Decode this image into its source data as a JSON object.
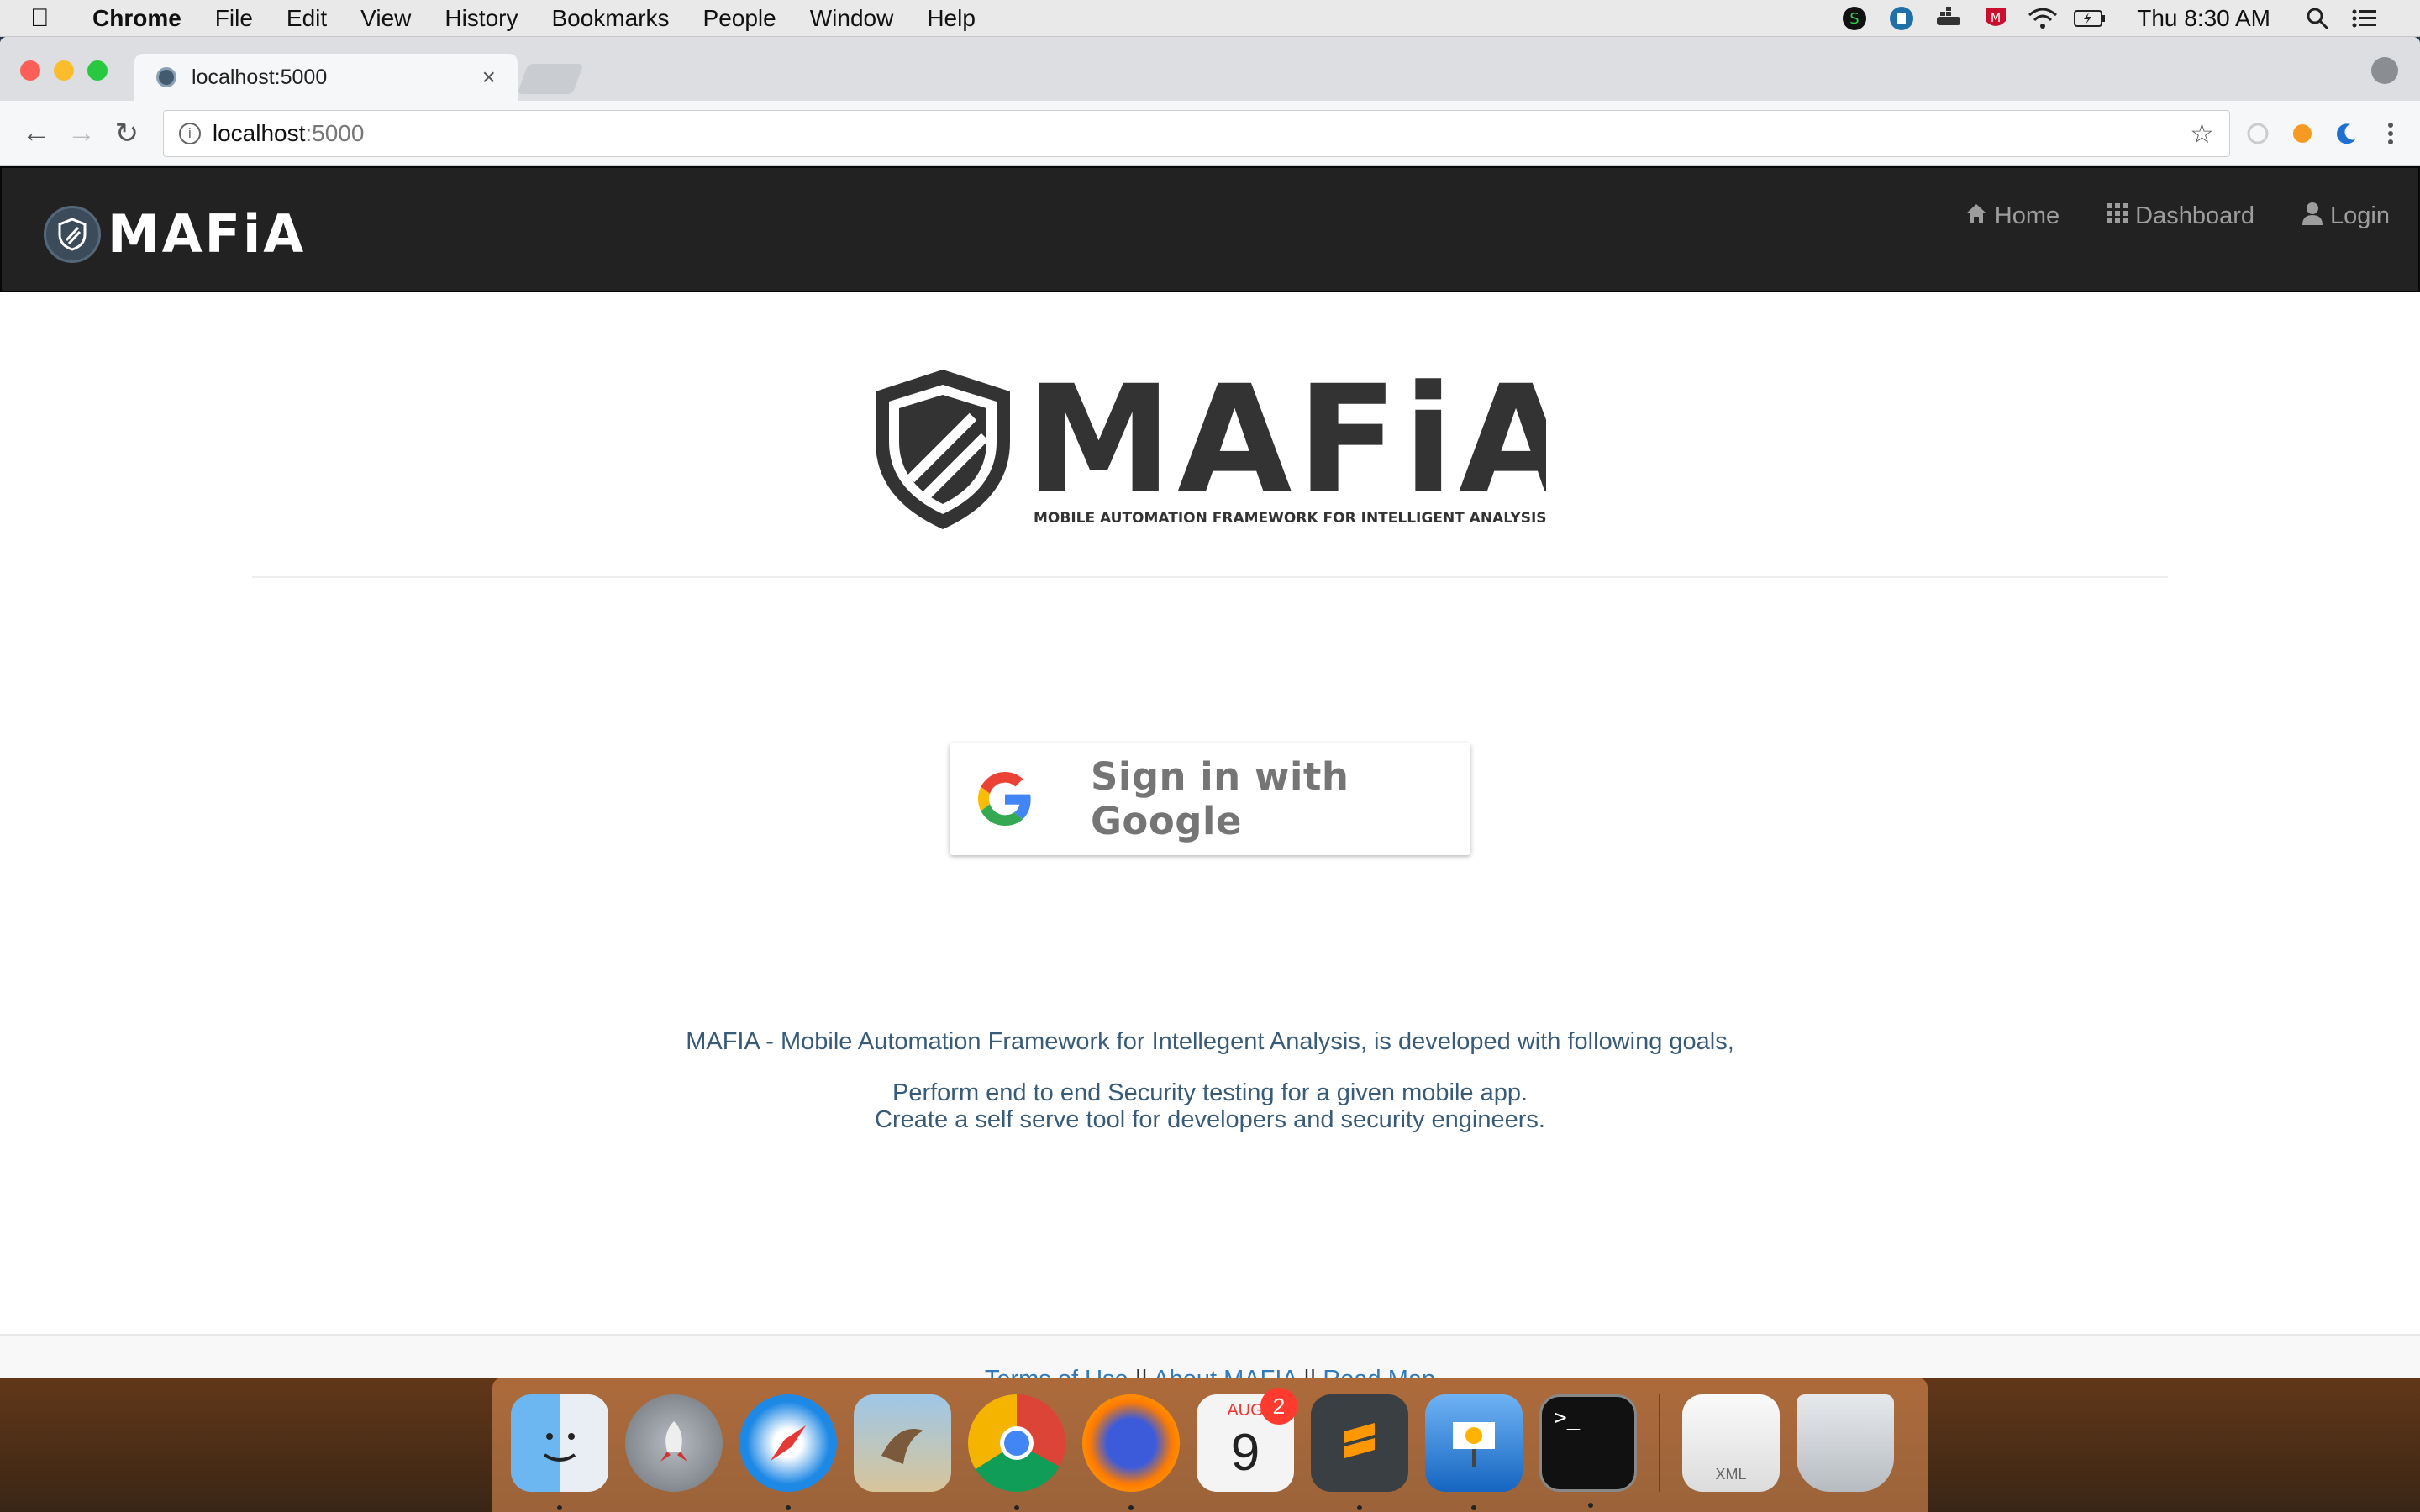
{
  "menubar": {
    "app_name": "Chrome",
    "items": [
      "File",
      "Edit",
      "View",
      "History",
      "Bookmarks",
      "People",
      "Window",
      "Help"
    ],
    "clock": "Thu 8:30 AM"
  },
  "browser": {
    "tab_title": "localhost:5000",
    "url_host": "localhost",
    "url_port": ":5000"
  },
  "navbar": {
    "brand": "MAFiA",
    "links": [
      {
        "label": "Home",
        "icon": "home-icon"
      },
      {
        "label": "Dashboard",
        "icon": "grid-icon"
      },
      {
        "label": "Login",
        "icon": "user-icon"
      }
    ]
  },
  "hero": {
    "logo_text": "MAFiA",
    "tagline": "MOBILE AUTOMATION FRAMEWORK FOR INTELLIGENT ANALYSIS"
  },
  "signin": {
    "label": "Sign in with Google"
  },
  "goals": {
    "intro": "MAFIA - Mobile Automation Framework for Intellegent Analysis, is developed with following goals,",
    "items": [
      "Perform end to end Security testing for a given mobile app.",
      "Create a self serve tool for developers and security engineers."
    ]
  },
  "footer": {
    "terms": "Terms of Use",
    "sep1": " || ",
    "about": "About MAFIA",
    "sep2": " || ",
    "roadmap": "Road Map"
  },
  "dock": {
    "calendar_month": "AUG",
    "calendar_day": "9",
    "calendar_badge": "2",
    "xml_label": "XML"
  },
  "colors": {
    "navbar_bg": "#222222",
    "link": "#337ab7",
    "goals_text": "#385b78",
    "logo_dark": "#333333"
  }
}
